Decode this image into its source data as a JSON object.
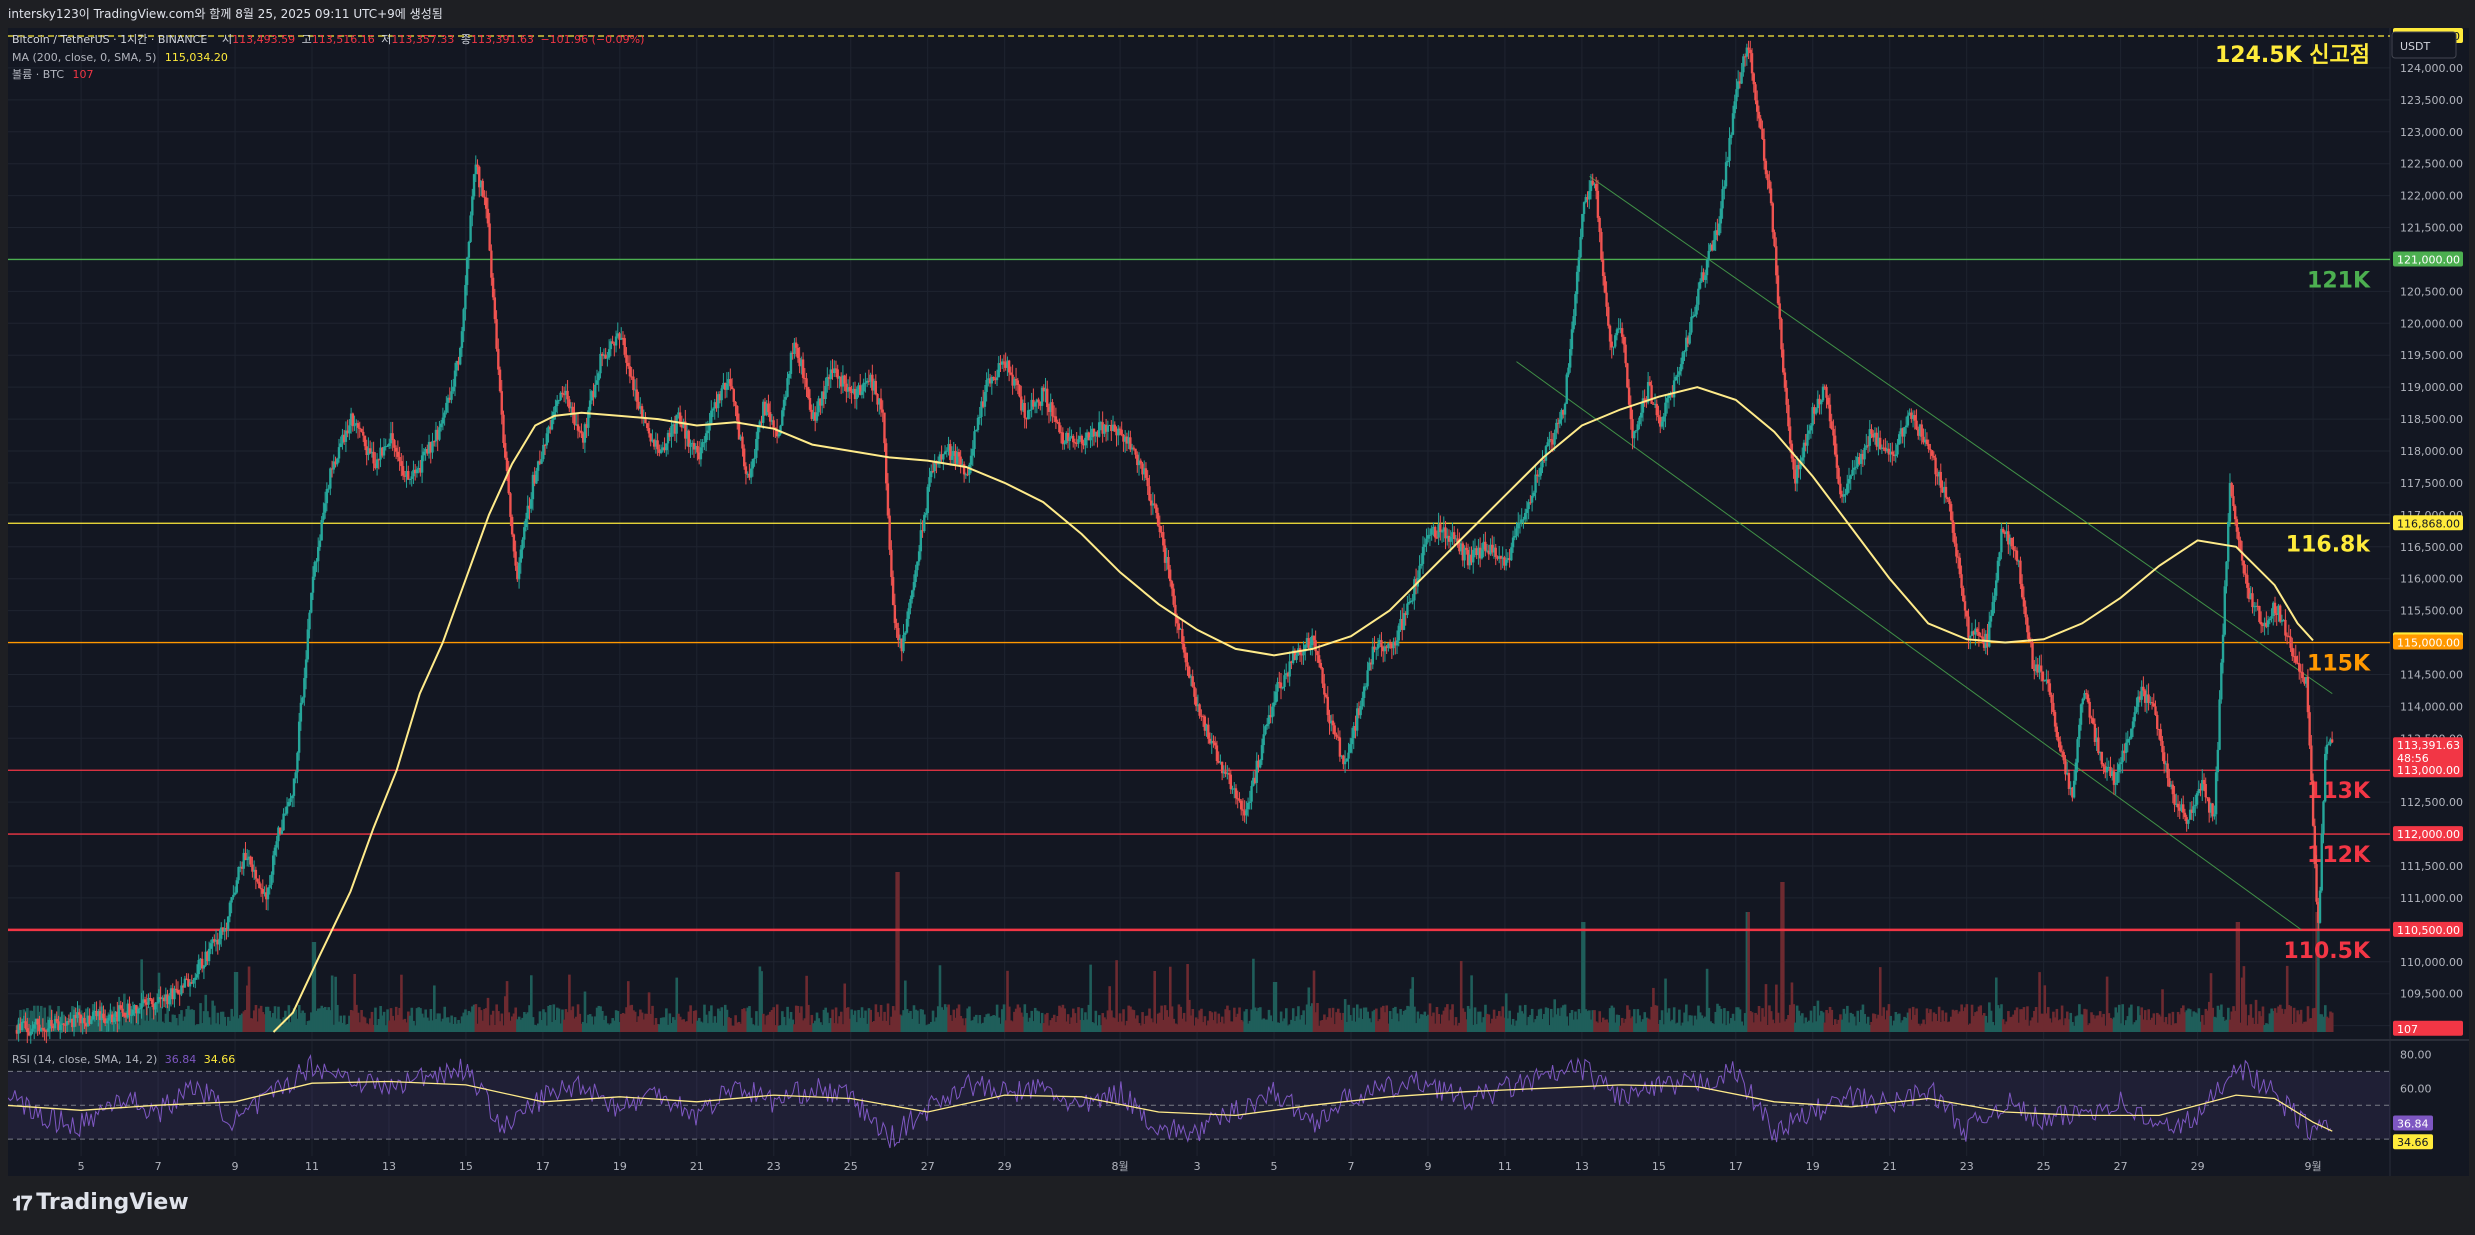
{
  "header": {
    "title": "intersky123이 TradingView.com와 함께 8월 25, 2025 09:11 UTC+9에 생성됨"
  },
  "legend": {
    "symbol": "Bitcoin / TetherUS · 1시간 · BINANCE",
    "open_label": "시",
    "open": "113,493.59",
    "high_label": "고",
    "high": "113,516.16",
    "low_label": "저",
    "low": "113,357.33",
    "close_label": "종",
    "close": "113,391.63",
    "change": "−101.96 (−0.09%)",
    "ma_label": "MA (200, close, 0, SMA, 5)",
    "ma_value": "115,034.20",
    "volume_label": "볼륨 · BTC",
    "volume_value": "107",
    "rsi_label": "RSI (14, close, SMA, 14, 2)",
    "rsi_value": "36.84",
    "rsi_ma_value": "34.66",
    "currency": "USDT"
  },
  "chart_data": {
    "type": "candlestick",
    "title": "Bitcoin / TetherUS · 1시간 · BINANCE",
    "ylabel": "USDT",
    "ylim": [
      108900,
      124500
    ],
    "y_ticks": [
      "109,000.00",
      "109,500.00",
      "110,000.00",
      "110,500.00",
      "111,000.00",
      "111,500.00",
      "112,000.00",
      "112,500.00",
      "113,000.00",
      "113,500.00",
      "114,000.00",
      "114,500.00",
      "115,000.00",
      "115,500.00",
      "116,000.00",
      "116,500.00",
      "117,000.00",
      "117,500.00",
      "118,000.00",
      "118,500.00",
      "119,000.00",
      "119,500.00",
      "120,000.00",
      "120,500.00",
      "121,000.00",
      "121,500.00",
      "122,000.00",
      "122,500.00",
      "123,000.00",
      "123,500.00",
      "124,000.00"
    ],
    "y_tick_values": [
      109000,
      109500,
      110000,
      110500,
      111000,
      111500,
      112000,
      112500,
      113000,
      113500,
      114000,
      114500,
      115000,
      115500,
      116000,
      116500,
      117000,
      117500,
      118000,
      118500,
      119000,
      119500,
      120000,
      120500,
      121000,
      121500,
      122000,
      122500,
      123000,
      123500,
      124000
    ],
    "x_ticks": [
      "5",
      "7",
      "9",
      "11",
      "13",
      "15",
      "17",
      "19",
      "21",
      "23",
      "25",
      "27",
      "29",
      "8월",
      "3",
      "5",
      "7",
      "9",
      "11",
      "13",
      "15",
      "17",
      "19",
      "21",
      "23",
      "25",
      "27",
      "29",
      "9월"
    ],
    "x_tick_days": [
      5,
      7,
      9,
      11,
      13,
      15,
      17,
      19,
      21,
      23,
      25,
      27,
      29,
      32,
      34,
      36,
      38,
      40,
      42,
      44,
      46,
      48,
      50,
      52,
      54,
      56,
      58,
      60,
      63
    ],
    "price_path": [
      [
        4,
        109000
      ],
      [
        6,
        109200
      ],
      [
        7.5,
        109500
      ],
      [
        8.7,
        110500
      ],
      [
        9.2,
        111700
      ],
      [
        9.8,
        111000
      ],
      [
        10,
        111800
      ],
      [
        10.5,
        112800
      ],
      [
        11,
        116000
      ],
      [
        11.5,
        117800
      ],
      [
        12,
        118500
      ],
      [
        12.6,
        117800
      ],
      [
        13,
        118200
      ],
      [
        13.5,
        117500
      ],
      [
        14,
        118000
      ],
      [
        14.4,
        118500
      ],
      [
        14.8,
        119500
      ],
      [
        15.2,
        122500
      ],
      [
        15.5,
        121800
      ],
      [
        16,
        117800
      ],
      [
        16.3,
        116000
      ],
      [
        16.7,
        117500
      ],
      [
        17.1,
        118300
      ],
      [
        17.5,
        119000
      ],
      [
        18,
        118200
      ],
      [
        18.5,
        119500
      ],
      [
        19,
        119800
      ],
      [
        19.5,
        118600
      ],
      [
        20,
        118000
      ],
      [
        20.5,
        118500
      ],
      [
        21,
        117900
      ],
      [
        21.4,
        118600
      ],
      [
        21.8,
        119200
      ],
      [
        22.3,
        117500
      ],
      [
        22.7,
        118700
      ],
      [
        23.1,
        118300
      ],
      [
        23.5,
        119800
      ],
      [
        24,
        118500
      ],
      [
        24.5,
        119300
      ],
      [
        25,
        118900
      ],
      [
        25.5,
        119100
      ],
      [
        25.8,
        118600
      ],
      [
        26.1,
        115200
      ],
      [
        26.3,
        114900
      ],
      [
        26.7,
        116300
      ],
      [
        27.1,
        117800
      ],
      [
        27.5,
        118000
      ],
      [
        28,
        117700
      ],
      [
        28.5,
        119000
      ],
      [
        29,
        119400
      ],
      [
        29.5,
        118600
      ],
      [
        30,
        118900
      ],
      [
        30.5,
        118200
      ],
      [
        31,
        118100
      ],
      [
        31.5,
        118400
      ],
      [
        32,
        118300
      ],
      [
        32.5,
        117800
      ],
      [
        33,
        116800
      ],
      [
        33.5,
        115200
      ],
      [
        34,
        114000
      ],
      [
        34.4,
        113300
      ],
      [
        34.8,
        112900
      ],
      [
        35.2,
        112300
      ],
      [
        35.6,
        113200
      ],
      [
        36,
        114200
      ],
      [
        36.5,
        114800
      ],
      [
        37,
        115100
      ],
      [
        37.4,
        113800
      ],
      [
        37.8,
        113100
      ],
      [
        38.2,
        114000
      ],
      [
        38.6,
        115000
      ],
      [
        39,
        114900
      ],
      [
        39.5,
        115600
      ],
      [
        40,
        116800
      ],
      [
        40.5,
        116700
      ],
      [
        41,
        116300
      ],
      [
        41.5,
        116500
      ],
      [
        42,
        116200
      ],
      [
        42.3,
        116800
      ],
      [
        42.7,
        117400
      ],
      [
        43,
        117900
      ],
      [
        43.5,
        118600
      ],
      [
        44,
        121800
      ],
      [
        44.3,
        122300
      ],
      [
        44.7,
        119600
      ],
      [
        45,
        120000
      ],
      [
        45.3,
        118200
      ],
      [
        45.7,
        119000
      ],
      [
        46,
        118500
      ],
      [
        46.5,
        119200
      ],
      [
        47,
        120500
      ],
      [
        47.5,
        121500
      ],
      [
        48,
        123700
      ],
      [
        48.3,
        124400
      ],
      [
        48.6,
        123000
      ],
      [
        48.9,
        121800
      ],
      [
        49.2,
        119300
      ],
      [
        49.5,
        117500
      ],
      [
        49.9,
        118500
      ],
      [
        50.3,
        119000
      ],
      [
        50.7,
        117300
      ],
      [
        51,
        117600
      ],
      [
        51.5,
        118300
      ],
      [
        52,
        117900
      ],
      [
        52.5,
        118600
      ],
      [
        53,
        118000
      ],
      [
        53.5,
        117200
      ],
      [
        54,
        115200
      ],
      [
        54.5,
        115000
      ],
      [
        54.9,
        116800
      ],
      [
        55.3,
        116300
      ],
      [
        55.7,
        114600
      ],
      [
        56,
        114500
      ],
      [
        56.3,
        113600
      ],
      [
        56.7,
        112600
      ],
      [
        57,
        114300
      ],
      [
        57.4,
        113300
      ],
      [
        57.8,
        112800
      ],
      [
        58.2,
        113600
      ],
      [
        58.5,
        114300
      ],
      [
        58.9,
        113800
      ],
      [
        59.3,
        112600
      ],
      [
        59.7,
        112200
      ],
      [
        60.1,
        112800
      ],
      [
        60.4,
        112200
      ],
      [
        60.8,
        117400
      ],
      [
        61,
        116800
      ],
      [
        61.3,
        115700
      ],
      [
        61.7,
        115300
      ],
      [
        62,
        115600
      ],
      [
        62.4,
        114900
      ],
      [
        62.8,
        114400
      ],
      [
        63.1,
        110500
      ],
      [
        63.3,
        113400
      ],
      [
        63.5,
        113391.63
      ]
    ],
    "ma200_path": [
      [
        10,
        108900
      ],
      [
        10.5,
        109200
      ],
      [
        11.2,
        110100
      ],
      [
        12,
        111100
      ],
      [
        12.6,
        112100
      ],
      [
        13.2,
        113000
      ],
      [
        13.8,
        114200
      ],
      [
        14.4,
        115000
      ],
      [
        15,
        116000
      ],
      [
        15.6,
        117000
      ],
      [
        16.2,
        117800
      ],
      [
        16.8,
        118400
      ],
      [
        17.3,
        118550
      ],
      [
        18,
        118600
      ],
      [
        19,
        118550
      ],
      [
        20,
        118500
      ],
      [
        21,
        118400
      ],
      [
        22,
        118450
      ],
      [
        23,
        118350
      ],
      [
        24,
        118100
      ],
      [
        25,
        118000
      ],
      [
        26,
        117900
      ],
      [
        27,
        117850
      ],
      [
        28,
        117750
      ],
      [
        29,
        117500
      ],
      [
        30,
        117200
      ],
      [
        31,
        116700
      ],
      [
        32,
        116100
      ],
      [
        33,
        115600
      ],
      [
        34,
        115200
      ],
      [
        35,
        114900
      ],
      [
        36,
        114800
      ],
      [
        37,
        114900
      ],
      [
        38,
        115100
      ],
      [
        39,
        115500
      ],
      [
        40,
        116100
      ],
      [
        41,
        116700
      ],
      [
        42,
        117300
      ],
      [
        43,
        117900
      ],
      [
        44,
        118400
      ],
      [
        45,
        118650
      ],
      [
        46,
        118850
      ],
      [
        47,
        119000
      ],
      [
        48,
        118800
      ],
      [
        49,
        118300
      ],
      [
        50,
        117600
      ],
      [
        51,
        116800
      ],
      [
        52,
        116000
      ],
      [
        53,
        115300
      ],
      [
        54,
        115050
      ],
      [
        55,
        115000
      ],
      [
        56,
        115050
      ],
      [
        57,
        115300
      ],
      [
        58,
        115700
      ],
      [
        59,
        116200
      ],
      [
        60,
        116600
      ],
      [
        61,
        116500
      ],
      [
        62,
        115900
      ],
      [
        62.6,
        115300
      ],
      [
        63,
        115034.2
      ]
    ],
    "horizontal_levels": [
      {
        "price": 124500,
        "label": "124.5K 신고점",
        "color": "#ffeb3b",
        "style": "dashed"
      },
      {
        "price": 121000,
        "label": "121K",
        "color": "#4caf50",
        "style": "solid"
      },
      {
        "price": 116868,
        "label": "116.8k",
        "color": "#ffeb3b",
        "style": "solid"
      },
      {
        "price": 115000,
        "label": "115K",
        "color": "#ff9800",
        "style": "solid"
      },
      {
        "price": 113000,
        "label": "113K",
        "color": "#f23645",
        "style": "solid"
      },
      {
        "price": 112000,
        "label": "112K",
        "color": "#f23645",
        "style": "solid"
      },
      {
        "price": 110500,
        "label": "110.5K",
        "color": "#f23645",
        "style": "solid"
      }
    ],
    "trend_channel": [
      {
        "from": [
          44.2,
          122300
        ],
        "to": [
          63.5,
          114200
        ],
        "color": "#4caf50"
      },
      {
        "from": [
          42.3,
          119400
        ],
        "to": [
          62.7,
          110500
        ],
        "color": "#4caf50"
      }
    ],
    "price_badges": [
      {
        "price": 124500,
        "text": "124,500.00",
        "color": "#ffeb3b"
      },
      {
        "price": 121000,
        "text": "121,000.00",
        "color": "#4caf50"
      },
      {
        "price": 116868,
        "text": "116,868.00",
        "color": "#ffeb3b"
      },
      {
        "price": 115034.2,
        "text": "115,034.20",
        "color": "#ffeb3b"
      },
      {
        "price": 115000,
        "text": "115,000.00",
        "color": "#ff9800"
      },
      {
        "price": 113391.63,
        "text": "113,391.63",
        "color": "#f23645",
        "sub": "48:56"
      },
      {
        "price": 113000,
        "text": "113,000.00",
        "color": "#f23645"
      },
      {
        "price": 112000,
        "text": "112,000.00",
        "color": "#f23645"
      },
      {
        "price": 110500,
        "text": "110,500.00",
        "color": "#f23645"
      },
      {
        "price": 108950,
        "text": "107",
        "color": "#f23645"
      }
    ],
    "rsi": {
      "ylim": [
        20,
        85
      ],
      "ticks": [
        "80.00",
        "60.00",
        "40.00"
      ],
      "tick_values": [
        80,
        60,
        40
      ],
      "bands": [
        70,
        50,
        30
      ],
      "last": "36.84",
      "ma_last": "34.66",
      "path": [
        [
          1,
          35
        ],
        [
          3,
          58
        ],
        [
          4,
          42
        ],
        [
          5,
          38
        ],
        [
          6,
          55
        ],
        [
          7,
          46
        ],
        [
          8,
          62
        ],
        [
          9,
          40
        ],
        [
          10,
          57
        ],
        [
          11,
          74
        ],
        [
          12,
          66
        ],
        [
          13,
          60
        ],
        [
          14,
          68
        ],
        [
          15,
          72
        ],
        [
          16,
          36
        ],
        [
          17,
          55
        ],
        [
          18,
          63
        ],
        [
          19,
          48
        ],
        [
          20,
          58
        ],
        [
          21,
          44
        ],
        [
          22,
          62
        ],
        [
          23,
          52
        ],
        [
          24,
          60
        ],
        [
          25,
          55
        ],
        [
          26,
          30
        ],
        [
          27,
          48
        ],
        [
          28,
          63
        ],
        [
          29,
          57
        ],
        [
          30,
          60
        ],
        [
          31,
          48
        ],
        [
          32,
          58
        ],
        [
          33,
          36
        ],
        [
          34,
          34
        ],
        [
          35,
          47
        ],
        [
          36,
          58
        ],
        [
          37,
          40
        ],
        [
          38,
          55
        ],
        [
          39,
          60
        ],
        [
          40,
          64
        ],
        [
          41,
          52
        ],
        [
          42,
          60
        ],
        [
          43,
          66
        ],
        [
          44,
          72
        ],
        [
          45,
          55
        ],
        [
          46,
          60
        ],
        [
          47,
          63
        ],
        [
          48,
          70
        ],
        [
          49,
          34
        ],
        [
          50,
          46
        ],
        [
          51,
          55
        ],
        [
          52,
          50
        ],
        [
          53,
          60
        ],
        [
          54,
          35
        ],
        [
          55,
          52
        ],
        [
          56,
          40
        ],
        [
          57,
          46
        ],
        [
          58,
          52
        ],
        [
          59,
          36
        ],
        [
          60,
          42
        ],
        [
          61,
          75
        ],
        [
          62,
          56
        ],
        [
          63,
          34
        ],
        [
          63.5,
          36.84
        ]
      ],
      "ma_path": [
        [
          1,
          42
        ],
        [
          3,
          50
        ],
        [
          5,
          47
        ],
        [
          7,
          50
        ],
        [
          9,
          52
        ],
        [
          11,
          63
        ],
        [
          13,
          64
        ],
        [
          15,
          62
        ],
        [
          17,
          52
        ],
        [
          19,
          55
        ],
        [
          21,
          52
        ],
        [
          23,
          56
        ],
        [
          25,
          54
        ],
        [
          27,
          46
        ],
        [
          29,
          56
        ],
        [
          31,
          55
        ],
        [
          33,
          46
        ],
        [
          35,
          44
        ],
        [
          37,
          50
        ],
        [
          39,
          55
        ],
        [
          41,
          58
        ],
        [
          43,
          60
        ],
        [
          45,
          62
        ],
        [
          47,
          61
        ],
        [
          49,
          52
        ],
        [
          51,
          49
        ],
        [
          53,
          54
        ],
        [
          55,
          46
        ],
        [
          57,
          44
        ],
        [
          59,
          44
        ],
        [
          61,
          56
        ],
        [
          62,
          54
        ],
        [
          63,
          40
        ],
        [
          63.5,
          34.66
        ]
      ]
    }
  }
}
